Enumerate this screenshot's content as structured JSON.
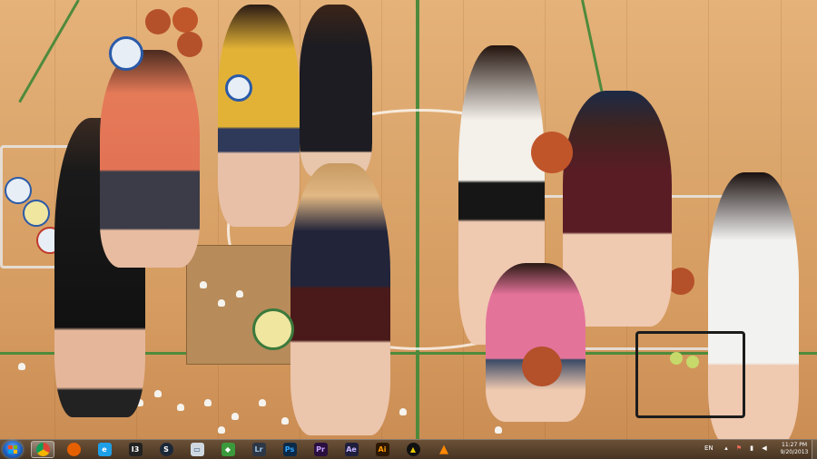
{
  "taskbar": {
    "start": {
      "icon": "windows-logo-icon"
    },
    "pinned": [
      {
        "name": "chrome",
        "icon": "chrome-icon",
        "label": "",
        "bg": "#e8e8e8",
        "fg": "#db4437",
        "active": true
      },
      {
        "name": "firefox",
        "icon": "firefox-icon",
        "label": "",
        "bg": "#e66000",
        "fg": "#ffcb00",
        "active": false
      },
      {
        "name": "internet-explorer",
        "icon": "internet-explorer-icon",
        "label": "e",
        "bg": "#1ea0e8",
        "fg": "#ffffff",
        "active": false
      },
      {
        "name": "i3",
        "icon": "i3-icon",
        "label": "I3",
        "bg": "#222222",
        "fg": "#ffffff",
        "active": false
      },
      {
        "name": "steam",
        "icon": "steam-icon",
        "label": "S",
        "bg": "#1b2838",
        "fg": "#ffffff",
        "active": false
      },
      {
        "name": "utility",
        "icon": "disk-utility-icon",
        "label": "▭",
        "bg": "#cfd8e0",
        "fg": "#2a4d75",
        "active": false
      },
      {
        "name": "green-app",
        "icon": "green-diamond-icon",
        "label": "◆",
        "bg": "#3b9a3b",
        "fg": "#ffffff",
        "active": false
      },
      {
        "name": "lightroom",
        "icon": "lightroom-icon",
        "label": "Lr",
        "bg": "#2d3745",
        "fg": "#9ec4e6",
        "active": false
      },
      {
        "name": "photoshop",
        "icon": "photoshop-icon",
        "label": "Ps",
        "bg": "#0b2a4a",
        "fg": "#31a8ff",
        "active": false
      },
      {
        "name": "premiere",
        "icon": "premiere-icon",
        "label": "Pr",
        "bg": "#2a0f3f",
        "fg": "#c6a2ff",
        "active": false
      },
      {
        "name": "after-effects",
        "icon": "after-effects-icon",
        "label": "Ae",
        "bg": "#1f1f3d",
        "fg": "#c7b4ff",
        "active": false
      },
      {
        "name": "illustrator",
        "icon": "illustrator-icon",
        "label": "Ai",
        "bg": "#2b1700",
        "fg": "#ff9a00",
        "active": false
      },
      {
        "name": "triangle-app",
        "icon": "triangle-icon",
        "label": "▲",
        "bg": "#111111",
        "fg": "#e8c800",
        "active": false
      },
      {
        "name": "vlc",
        "icon": "vlc-cone-icon",
        "label": "▲",
        "bg": "transparent",
        "fg": "#ff8800",
        "active": false
      }
    ],
    "tray": {
      "language": "EN",
      "icons": [
        {
          "name": "show-hidden-icons",
          "glyph": "▴"
        },
        {
          "name": "action-center-flag",
          "glyph": "⚑"
        },
        {
          "name": "network-signal",
          "glyph": "▮"
        },
        {
          "name": "volume",
          "glyph": "◀"
        }
      ],
      "time": "11:27 PM",
      "date": "9/20/2013"
    }
  }
}
